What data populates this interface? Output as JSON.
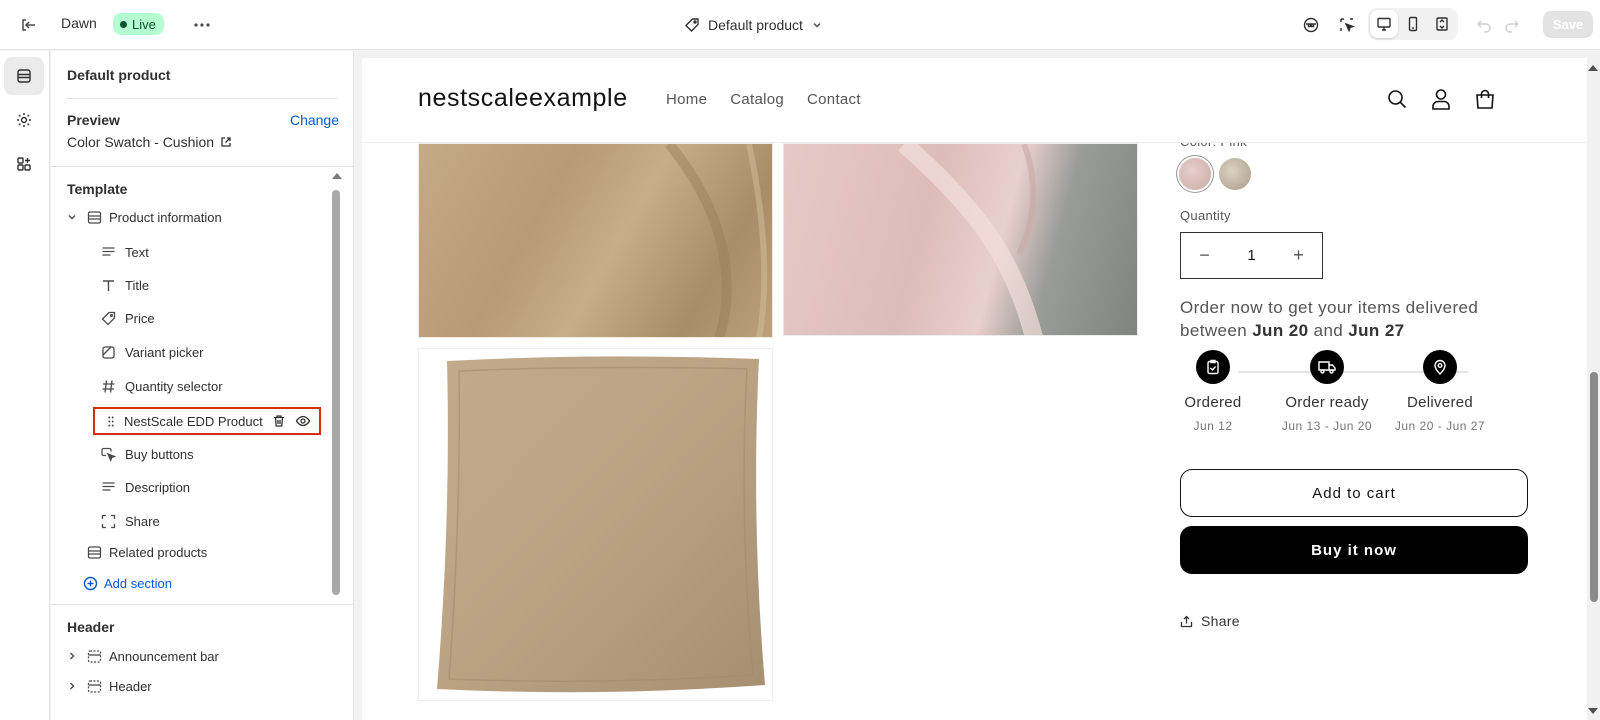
{
  "topbar": {
    "theme_name": "Dawn",
    "status": "Live",
    "template_name": "Default product",
    "save_label": "Save"
  },
  "sidebar": {
    "title": "Default product",
    "preview_label": "Preview",
    "change_label": "Change",
    "preview_value": "Color Swatch - Cushion",
    "template_heading": "Template",
    "section_name": "Product information",
    "blocks": [
      {
        "label": "Text",
        "icon": "text-icon"
      },
      {
        "label": "Title",
        "icon": "title-icon"
      },
      {
        "label": "Price",
        "icon": "price-tag-icon"
      },
      {
        "label": "Variant picker",
        "icon": "variant-icon"
      },
      {
        "label": "Quantity selector",
        "icon": "hash-icon"
      }
    ],
    "selected_block": "NestScale EDD Product",
    "blocks_after": [
      {
        "label": "Buy buttons",
        "icon": "cursor-icon"
      },
      {
        "label": "Description",
        "icon": "text-icon"
      },
      {
        "label": "Share",
        "icon": "share-icon"
      }
    ],
    "related_products": "Related products",
    "add_section": "Add section",
    "header_heading": "Header",
    "header_sections": [
      "Announcement bar",
      "Header"
    ]
  },
  "store": {
    "logo": "nestscaleexample",
    "nav": [
      "Home",
      "Catalog",
      "Contact"
    ]
  },
  "product": {
    "color_label": "Color: Pink",
    "quantity_label": "Quantity",
    "quantity_value": "1",
    "edd_prefix": "Order now to get your items delivered between ",
    "edd_start": "Jun 20",
    "edd_and": " and ",
    "edd_end": "Jun 27",
    "steps": [
      {
        "label": "Ordered",
        "date": "Jun 12"
      },
      {
        "label": "Order ready",
        "date": "Jun 13 - Jun 20"
      },
      {
        "label": "Delivered",
        "date": "Jun 20 - Jun 27"
      }
    ],
    "add_to_cart": "Add to cart",
    "buy_now": "Buy it now",
    "share": "Share"
  },
  "colors": {
    "accent_link": "#005bd3",
    "live_badge_bg": "#b4fed2",
    "highlight_border": "#d72c0d"
  }
}
